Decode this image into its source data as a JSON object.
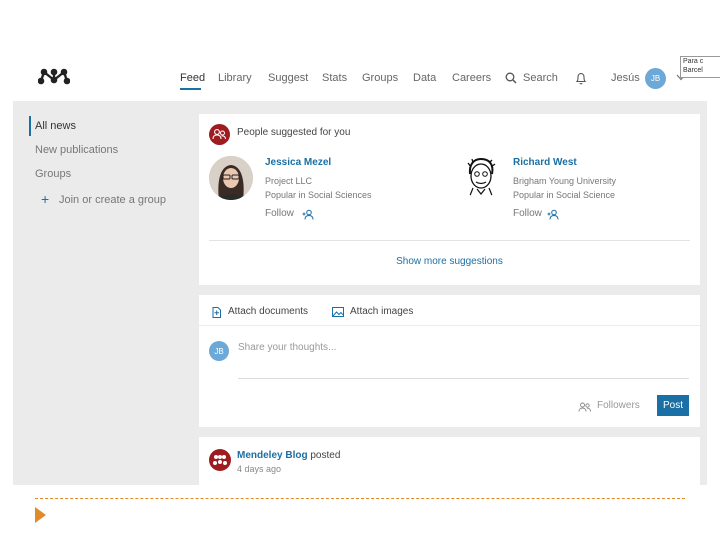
{
  "nav": {
    "items": [
      "Feed",
      "Library",
      "Suggest",
      "Stats",
      "Groups",
      "Data",
      "Careers"
    ],
    "search_label": "Search",
    "user_name": "Jesús",
    "avatar_initials": "JB"
  },
  "corner_note": "Para c\nBarcel",
  "sidebar": {
    "items": [
      "All news",
      "New publications",
      "Groups"
    ],
    "join_label": "Join or create a group"
  },
  "suggestions": {
    "heading": "People suggested for you",
    "people": [
      {
        "name": "Jessica Mezel",
        "org": "Project LLC",
        "topic": "Popular in Social Sciences",
        "follow": "Follow"
      },
      {
        "name": "Richard West",
        "org": "Brigham Young University",
        "topic": "Popular in Social Science",
        "follow": "Follow"
      }
    ],
    "show_more": "Show more suggestions"
  },
  "composer": {
    "attach_documents": "Attach documents",
    "attach_images": "Attach images",
    "placeholder": "Share your thoughts...",
    "audience": "Followers",
    "post_label": "Post",
    "avatar_initials": "JB"
  },
  "feed_item": {
    "author": "Mendeley Blog",
    "action": " posted",
    "time": "4 days ago"
  },
  "colors": {
    "accent": "#1a6fa4",
    "brand_red": "#9e1b20",
    "slide_orange": "#e08a2c"
  }
}
